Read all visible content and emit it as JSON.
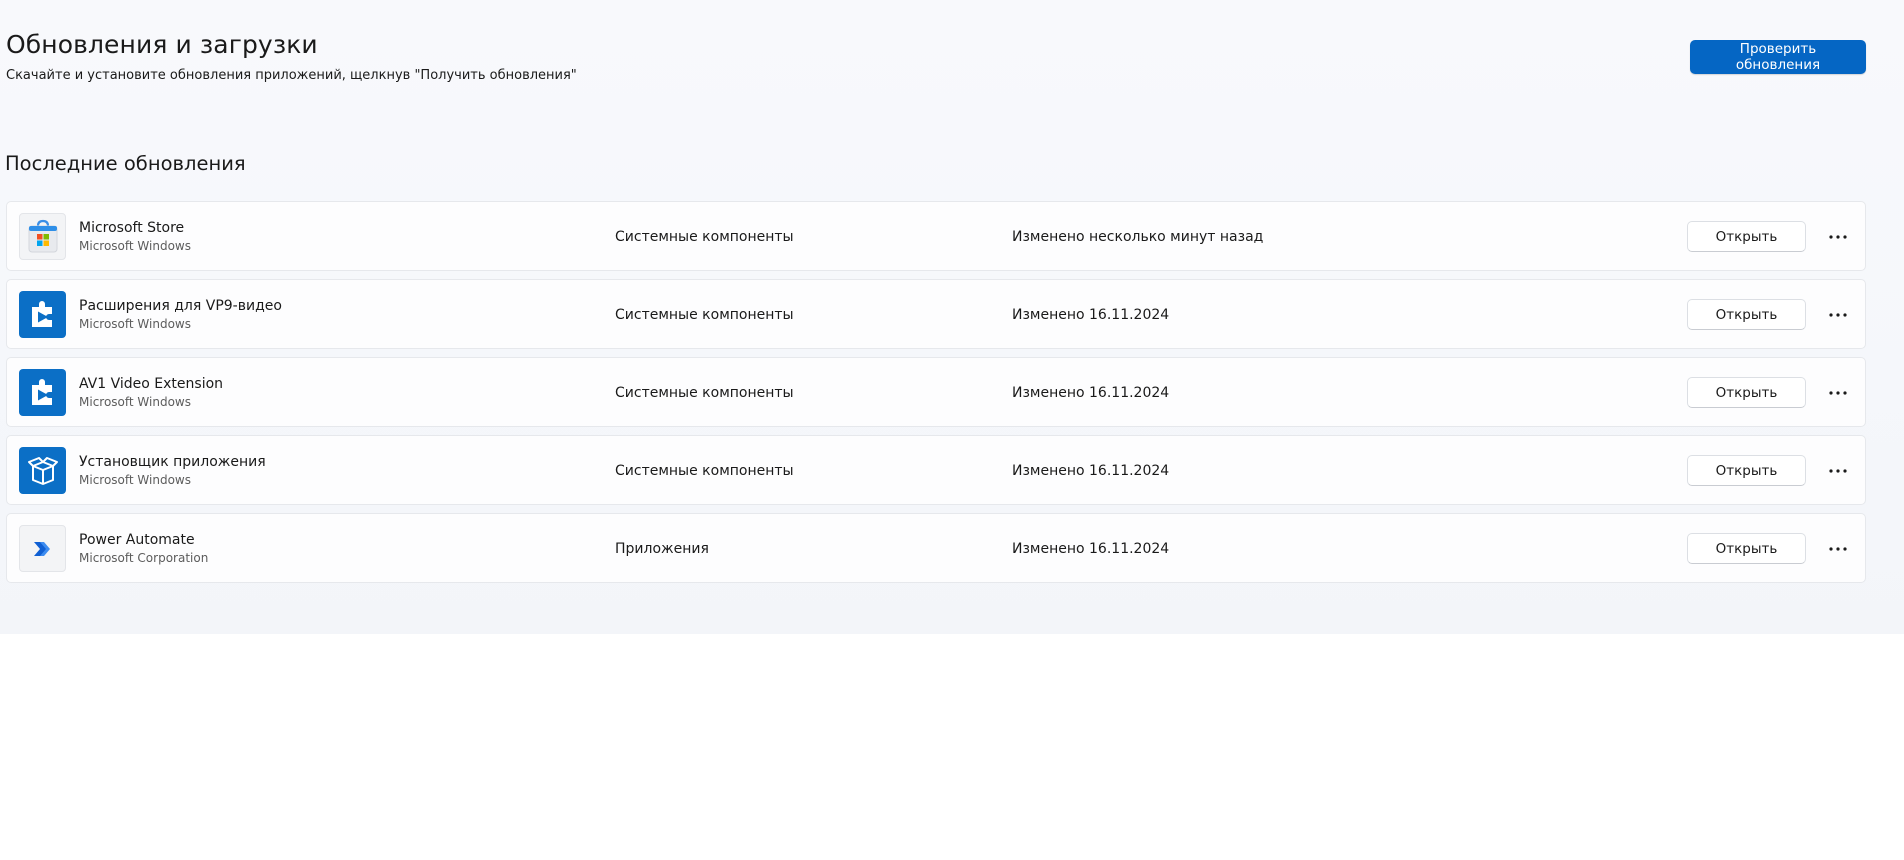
{
  "header": {
    "title": "Обновления и загрузки",
    "subtitle": "Скачайте и установите обновления приложений, щелкнув \"Получить обновления\"",
    "check_updates_label": "Проверить обновления"
  },
  "recent": {
    "section_title": "Последние обновления",
    "items": [
      {
        "name": "Microsoft Store",
        "publisher": "Microsoft Windows",
        "category": "Системные компоненты",
        "modified": "Изменено несколько минут назад",
        "open_label": "Открыть",
        "icon": "microsoft-store-icon"
      },
      {
        "name": "Расширения для VP9-видео",
        "publisher": "Microsoft Windows",
        "category": "Системные компоненты",
        "modified": "Изменено 16.11.2024",
        "open_label": "Открыть",
        "icon": "video-extension-icon"
      },
      {
        "name": "AV1 Video Extension",
        "publisher": "Microsoft Windows",
        "category": "Системные компоненты",
        "modified": "Изменено 16.11.2024",
        "open_label": "Открыть",
        "icon": "video-extension-icon"
      },
      {
        "name": "Установщик приложения",
        "publisher": "Microsoft Windows",
        "category": "Системные компоненты",
        "modified": "Изменено 16.11.2024",
        "open_label": "Открыть",
        "icon": "app-installer-icon"
      },
      {
        "name": "Power Automate",
        "publisher": "Microsoft Corporation",
        "category": "Приложения",
        "modified": "Изменено 16.11.2024",
        "open_label": "Открыть",
        "icon": "power-automate-icon"
      }
    ]
  },
  "colors": {
    "accent": "#0566c4",
    "icon_blue": "#0b6fc6"
  }
}
